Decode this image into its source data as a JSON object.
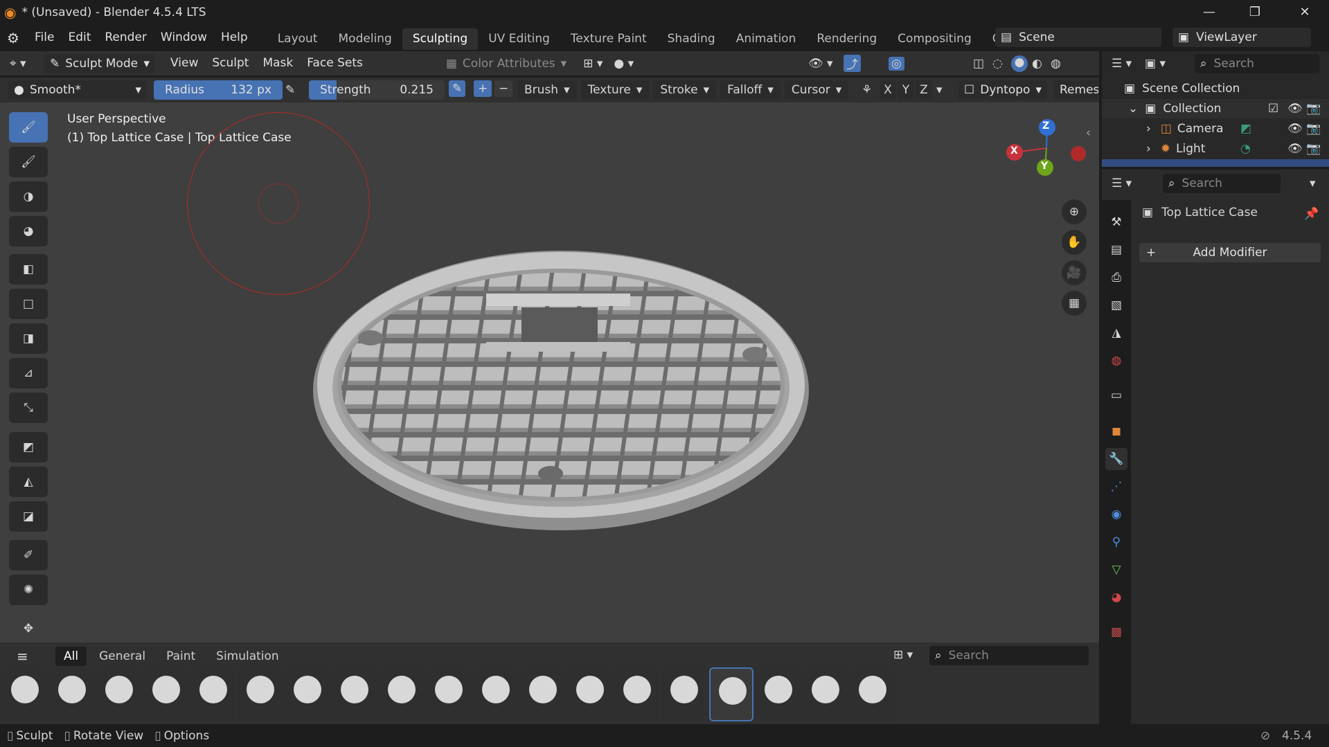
{
  "window": {
    "title": "* (Unsaved) - Blender 4.5.4 LTS"
  },
  "menu": [
    "File",
    "Edit",
    "Render",
    "Window",
    "Help"
  ],
  "workspaces": [
    "Layout",
    "Modeling",
    "Sculpting",
    "UV Editing",
    "Texture Paint",
    "Shading",
    "Animation",
    "Rendering",
    "Compositing",
    "Geome"
  ],
  "scene": {
    "label": "Scene",
    "viewlayer": "ViewLayer"
  },
  "header": {
    "mode": "Sculpt Mode",
    "menus": [
      "View",
      "Sculpt",
      "Mask",
      "Face Sets"
    ],
    "color_attributes": "Color Attributes"
  },
  "toolsettings": {
    "brush_name": "Smooth*",
    "radius_label": "Radius",
    "radius_value": "132 px",
    "strength_label": "Strength",
    "strength_value": "0.215",
    "dropdowns": [
      "Brush",
      "Texture",
      "Stroke",
      "Falloff",
      "Cursor"
    ],
    "axes": [
      "X",
      "Y",
      "Z"
    ],
    "dyntopo": "Dyntopo",
    "remesh": "Remes"
  },
  "viewport": {
    "perspective": "User Perspective",
    "object_info": "(1) Top Lattice Case | Top Lattice Case"
  },
  "gizmo": {
    "x": "X",
    "y": "Y",
    "z": "Z",
    "x_color": "#c8323c",
    "y_color": "#6fa51b",
    "z_color": "#2f6fd6"
  },
  "brush_panel": {
    "tabs": [
      "All",
      "General",
      "Paint",
      "Simulation"
    ],
    "search_placeholder": "Search"
  },
  "outliner": {
    "search_placeholder": "Search",
    "root": "Scene Collection",
    "collection": "Collection",
    "items": [
      "Camera",
      "Light"
    ]
  },
  "properties": {
    "search_placeholder": "Search",
    "object_name": "Top Lattice Case",
    "add_modifier": "Add Modifier"
  },
  "statusbar": {
    "items": [
      "Sculpt",
      "Rotate View",
      "Options"
    ],
    "version": "4.5.4"
  },
  "colors": {
    "accent": "#4772b3",
    "viewport_bg": "#3f3f3f",
    "panel": "#303030"
  }
}
